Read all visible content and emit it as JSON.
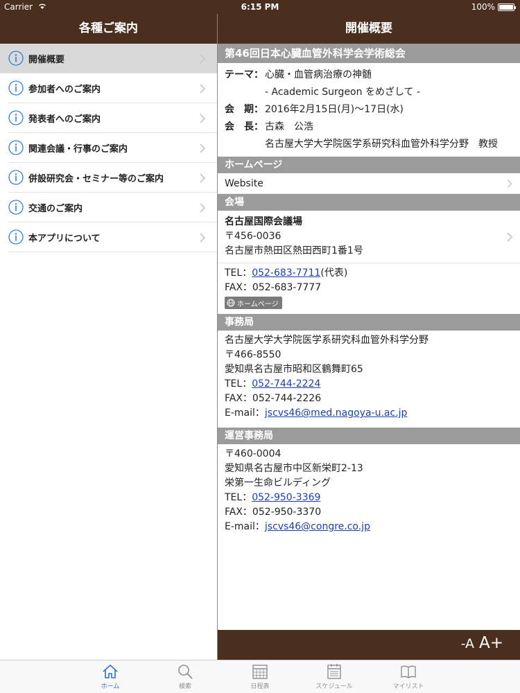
{
  "status": {
    "carrier": "Carrier",
    "time": "6:15 PM",
    "battery": "100%"
  },
  "left": {
    "title": "各種ご案内",
    "items": [
      {
        "label": "開催概要"
      },
      {
        "label": "参加者へのご案内"
      },
      {
        "label": "発表者へのご案内"
      },
      {
        "label": "関連会議・行事のご案内"
      },
      {
        "label": "併設研究会・セミナー等のご案内"
      },
      {
        "label": "交通のご案内"
      },
      {
        "label": "本アプリについて"
      }
    ]
  },
  "right": {
    "title": "開催概要",
    "conference": {
      "name": "第46回日本心臓血管外科学会学術総会",
      "theme_key": "テーマ：",
      "theme_line1": "心臓・血管病治療の神髄",
      "theme_line2": "- Academic Surgeon をめざして -",
      "period_key": "会　期：",
      "period": "2016年2月15日(月)～17日(水)",
      "chair_key": "会　長：",
      "chair_name": "古森　公浩",
      "chair_affiliation": "名古屋大学大学院医学系研究科血管外科学分野　教授"
    },
    "homepage": {
      "header": "ホームページ",
      "website_label": "Website"
    },
    "venue": {
      "header": "会場",
      "name": "名古屋国際会議場",
      "postal": "〒456-0036",
      "address": "名古屋市熱田区熱田西町1番1号",
      "tel_prefix": "TEL：",
      "tel": "052-683-7711",
      "tel_suffix": "(代表)",
      "fax": "FAX：052-683-7777",
      "hp_badge": "ホームページ"
    },
    "secretariat": {
      "header": "事務局",
      "org": "名古屋大学大学院医学系研究科血管外科学分野",
      "postal": "〒466-8550",
      "address": "愛知県名古屋市昭和区鶴舞町65",
      "tel_prefix": "TEL：",
      "tel": "052-744-2224",
      "fax": "FAX：052-744-2226",
      "email_prefix": "E-mail：",
      "email": "jscvs46@med.nagoya-u.ac.jp"
    },
    "management": {
      "header": "運営事務局",
      "postal": "〒460-0004",
      "address": "愛知県名古屋市中区新栄町2-13",
      "building": "栄第一生命ビルディング",
      "tel_prefix": "TEL：",
      "tel": "052-950-3369",
      "fax": "FAX：052-950-3370",
      "email_prefix": "E-mail：",
      "email": "jscvs46@congre.co.jp"
    },
    "font_minus": "-A",
    "font_plus": "A+"
  },
  "tabs": [
    {
      "label": "ホーム"
    },
    {
      "label": "検索"
    },
    {
      "label": "日程表"
    },
    {
      "label": "スケジュール"
    },
    {
      "label": "マイリスト"
    }
  ],
  "colors": {
    "bar": "#4a2f1e",
    "section": "#9b9b9b",
    "link": "#1a3fb3",
    "active_tab": "#2f6fd0"
  }
}
